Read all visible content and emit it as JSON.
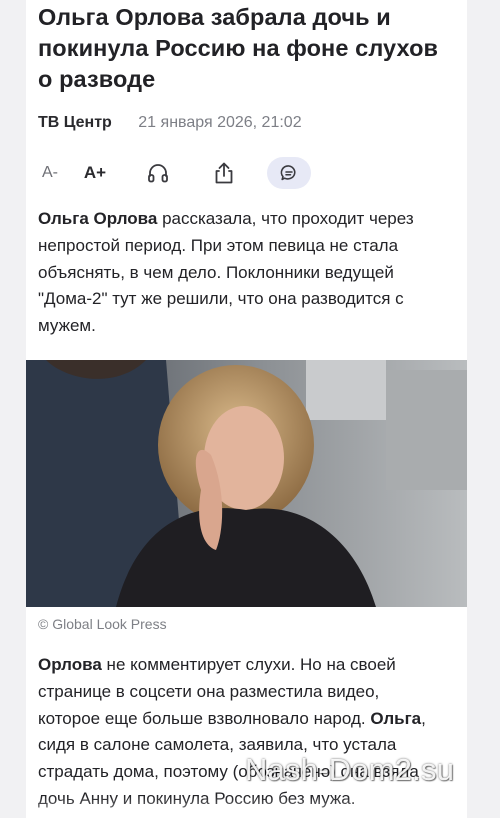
{
  "article": {
    "title": "Ольга Орлова забрала дочь и покинула Россию на фоне слухов о разводе",
    "source": "ТВ Центр",
    "date": "21 января 2026, 21:02"
  },
  "toolbar": {
    "font_decrease_label": "A-",
    "font_increase_label": "A+",
    "icons": [
      "headphones-icon",
      "share-icon",
      "comment-icon"
    ],
    "comments_bg": "#e7e9f6"
  },
  "body": {
    "p1": {
      "bold": "Ольга Орлова",
      "text": " рассказала, что проходит через непростой период. При этом певица не стала объяснять, в чем дело. Поклонники ведущей \"Дома-2\" тут же решили, что она разводится с мужем."
    },
    "photo_caption": "© Global Look Press",
    "p2": {
      "bold1": "Орлова",
      "text1": " не комментирует слухи. Но на своей странице в соцсети она разместила видео, которое еще больше взволновало народ. ",
      "bold2": "Ольга",
      "text2": ", сидя в салоне самолета, заявила, что устала страдать дома, поэтому (обозначено) она взяла дочь Анну и покинула Россию без мужа."
    }
  },
  "watermark": "Nash-Dom2.su"
}
